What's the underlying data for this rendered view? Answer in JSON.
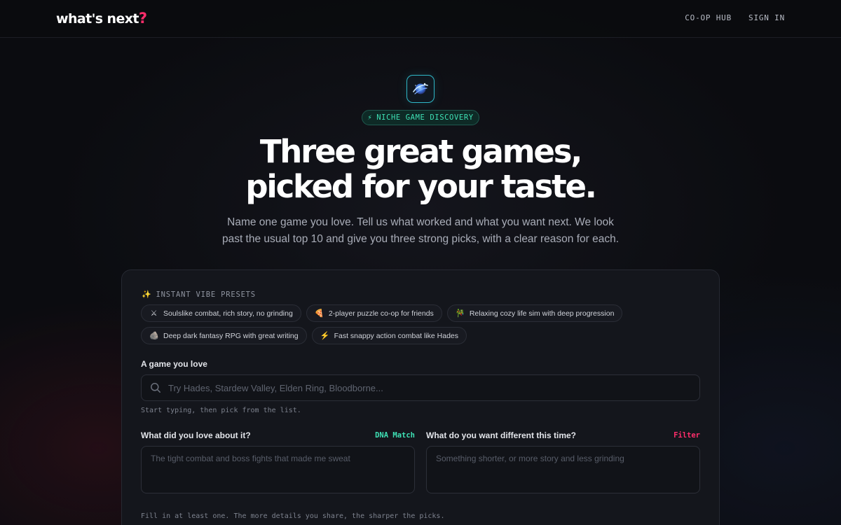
{
  "nav": {
    "logo_text": "what's next",
    "logo_mark": "?",
    "links": [
      "CO-OP HUB",
      "SIGN IN"
    ]
  },
  "hero": {
    "badge_icon": "⚡",
    "badge": "NICHE GAME DISCOVERY",
    "headline_line1": "Three great games,",
    "headline_line2": "picked for your taste.",
    "subhead_line1": "Name one game you love. Tell us what worked and what you want next. We look",
    "subhead_line2": "past the usual top 10 and give you three strong picks, with a clear reason for each."
  },
  "form": {
    "presets_icon": "✨",
    "presets_title": "INSTANT VIBE PRESETS",
    "presets": [
      {
        "emoji": "⚔",
        "label": "Soulslike combat, rich story, no grinding"
      },
      {
        "emoji": "🍕",
        "label": "2-player puzzle co-op for friends"
      },
      {
        "emoji": "🎋",
        "label": "Relaxing cozy life sim with deep progression"
      },
      {
        "emoji": "🪨",
        "label": "Deep dark fantasy RPG with great writing"
      },
      {
        "emoji": "⚡",
        "label": "Fast snappy action combat like Hades"
      }
    ],
    "game_label": "A game you love",
    "game_placeholder": "Try Hades, Stardew Valley, Elden Ring, Bloodborne...",
    "game_hint": "Start typing, then pick from the list.",
    "loved_label": "What did you love about it?",
    "loved_tag": "DNA Match",
    "loved_placeholder": "The tight combat and boss fights that made me sweat",
    "different_label": "What do you want different this time?",
    "different_tag": "Filter",
    "different_placeholder": "Something shorter, or more story and less grinding",
    "footer_hint": "Fill in at least one. The more details you share, the sharper the picks."
  },
  "colors": {
    "accent_teal": "#3ee0b4",
    "accent_pink": "#ff2d6b",
    "background": "#0b0c10"
  },
  "icons": {
    "app_icon": "swirl-planet-icon",
    "search": "search-icon"
  }
}
